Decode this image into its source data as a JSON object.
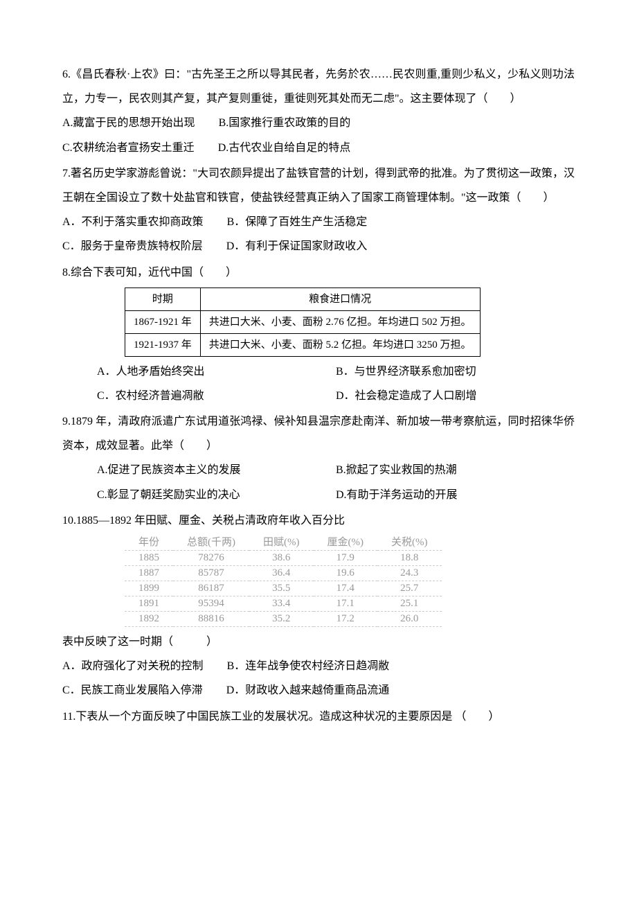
{
  "q6": {
    "text": "6.《昌氏春秋·上农》曰：\"古先圣王之所以导其民者，先务於农……民农则重,重则少私义，少私义则功法立，力专一，民农则其产复，其产复则重徙，重徙则死其处而无二虑\"。这主要体现了（　　）",
    "optA": "A.藏富于民的思想开始出现",
    "optB": "B.国家推行重农政策的目的",
    "optC": "C.农耕统治者宣扬安土重迁",
    "optD": "D.古代农业自给自足的特点"
  },
  "q7": {
    "text": "7.著名历史学家游彪曾说：\"大司农颜异提出了盐铁官营的计划，得到武帝的批准。为了贯彻这一政策，汉王朝在全国设立了数十处盐官和铁官，使盐铁经营真正纳入了国家工商管理体制。\"这一政策（　　）",
    "optA": "A．不利于落实重农抑商政策",
    "optB": "B．保障了百姓生产生活稳定",
    "optC": "C．服务于皇帝贵族特权阶层",
    "optD": "D．有利于保证国家财政收入"
  },
  "q8": {
    "text": "8.综合下表可知，近代中国（　　）",
    "table": {
      "h1": "时期",
      "h2": "粮食进口情况",
      "r1c1": "1867-1921 年",
      "r1c2": "共进口大米、小麦、面粉 2.76 亿担。年均进口 502 万担。",
      "r2c1": "1921-1937 年",
      "r2c2": "共进口大米、小麦、面粉 5.2 亿担。年均进口 3250 万担。"
    },
    "optA": "A．人地矛盾始终突出",
    "optB": "B．与世界经济联系愈加密切",
    "optC": "C．农村经济普遍凋敝",
    "optD": "D．社会稳定造成了人口剧增"
  },
  "q9": {
    "text": "9.1879 年，清政府派遣广东试用道张鸿禄、候补知县温宗彦赴南洋、新加坡一带考察航运，同时招徕华侨资本，成效显著。此举（　　）",
    "optA": "A.促进了民族资本主义的发展",
    "optB": "B.掀起了实业救国的热潮",
    "optC": "C.彰显了朝廷奖励实业的决心",
    "optD": "D.有助于洋务运动的开展"
  },
  "q10": {
    "text": "10.1885—1892 年田赋、厘金、关税占清政府年收入百分比",
    "headers": [
      "年份",
      "总额(千两)",
      "田赋(%)",
      "厘金(%)",
      "关税(%)"
    ],
    "rows": [
      [
        "1885",
        "78276",
        "38.6",
        "17.9",
        "18.8"
      ],
      [
        "1887",
        "85787",
        "36.4",
        "19.6",
        "24.3"
      ],
      [
        "1899",
        "86187",
        "35.5",
        "17.4",
        "25.7"
      ],
      [
        "1891",
        "95394",
        "33.4",
        "17.1",
        "25.1"
      ],
      [
        "1892",
        "88816",
        "35.2",
        "17.2",
        "26.0"
      ]
    ],
    "tail": "表中反映了这一时期（　　　）",
    "optA": "A．政府强化了对关税的控制",
    "optB": "B．连年战争使农村经济日趋凋敝",
    "optC": "C．民族工商业发展陷入停滞",
    "optD": "D．财政收入越来越倚重商品流通"
  },
  "q11": {
    "text": "11.下表从一个方面反映了中国民族工业的发展状况。造成这种状况的主要原因是 （　　）"
  },
  "chart_data": {
    "type": "table",
    "title": "1885—1892 年田赋、厘金、关税占清政府年收入百分比",
    "columns": [
      "年份",
      "总额(千两)",
      "田赋(%)",
      "厘金(%)",
      "关税(%)"
    ],
    "rows": [
      {
        "年份": 1885,
        "总额(千两)": 78276,
        "田赋(%)": 38.6,
        "厘金(%)": 17.9,
        "关税(%)": 18.8
      },
      {
        "年份": 1887,
        "总额(千两)": 85787,
        "田赋(%)": 36.4,
        "厘金(%)": 19.6,
        "关税(%)": 24.3
      },
      {
        "年份": 1899,
        "总额(千两)": 86187,
        "田赋(%)": 35.5,
        "厘金(%)": 17.4,
        "关税(%)": 25.7
      },
      {
        "年份": 1891,
        "总额(千两)": 95394,
        "田赋(%)": 33.4,
        "厘金(%)": 17.1,
        "关税(%)": 25.1
      },
      {
        "年份": 1892,
        "总额(千两)": 88816,
        "田赋(%)": 35.2,
        "厘金(%)": 17.2,
        "关税(%)": 26.0
      }
    ]
  }
}
